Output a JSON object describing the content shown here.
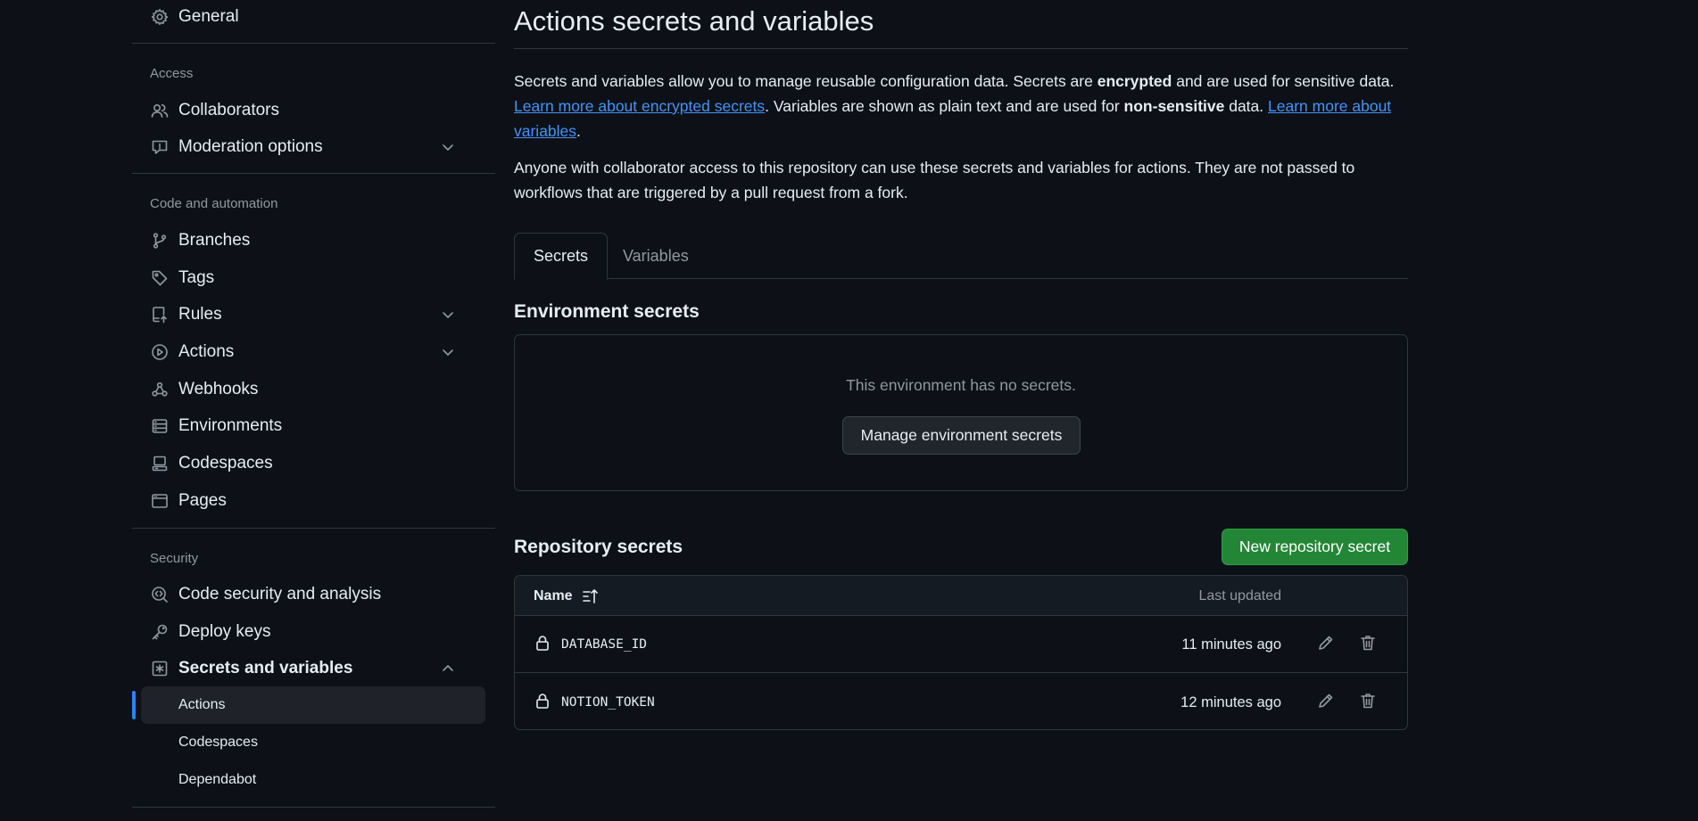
{
  "sidebar": {
    "general": "General",
    "access_heading": "Access",
    "collaborators": "Collaborators",
    "moderation": "Moderation options",
    "code_heading": "Code and automation",
    "branches": "Branches",
    "tags": "Tags",
    "rules": "Rules",
    "actions": "Actions",
    "webhooks": "Webhooks",
    "environments": "Environments",
    "codespaces": "Codespaces",
    "pages": "Pages",
    "security_heading": "Security",
    "code_security": "Code security and analysis",
    "deploy_keys": "Deploy keys",
    "secrets_vars": "Secrets and variables",
    "sub_actions": "Actions",
    "sub_codespaces": "Codespaces",
    "sub_dependabot": "Dependabot"
  },
  "main": {
    "title": "Actions secrets and variables",
    "intro": {
      "t1": "Secrets and variables allow you to manage reusable configuration data. Secrets are ",
      "b1": "encrypted",
      "t2": " and are used for sensitive data. ",
      "link1": "Learn more about encrypted secrets",
      "t3": ". Variables are shown as plain text and are used for ",
      "b2": "non-sensitive",
      "t4": " data. ",
      "link2": "Learn more about variables",
      "t5": "."
    },
    "notice": "Anyone with collaborator access to this repository can use these secrets and variables for actions. They are not passed to workflows that are triggered by a pull request from a fork.",
    "tabs": [
      "Secrets",
      "Variables"
    ],
    "env_heading": "Environment secrets",
    "env_empty": "This environment has no secrets.",
    "env_button": "Manage environment secrets",
    "repo_heading": "Repository secrets",
    "new_button": "New repository secret",
    "table": {
      "col_name": "Name",
      "col_updated": "Last updated",
      "rows": [
        {
          "name": "DATABASE_ID",
          "updated": "11 minutes ago"
        },
        {
          "name": "NOTION_TOKEN",
          "updated": "12 minutes ago"
        }
      ]
    }
  },
  "colors": {
    "background": "#0d1117",
    "link": "#4493f8",
    "primary_button": "#238636",
    "active_indicator": "#2f81f7"
  }
}
